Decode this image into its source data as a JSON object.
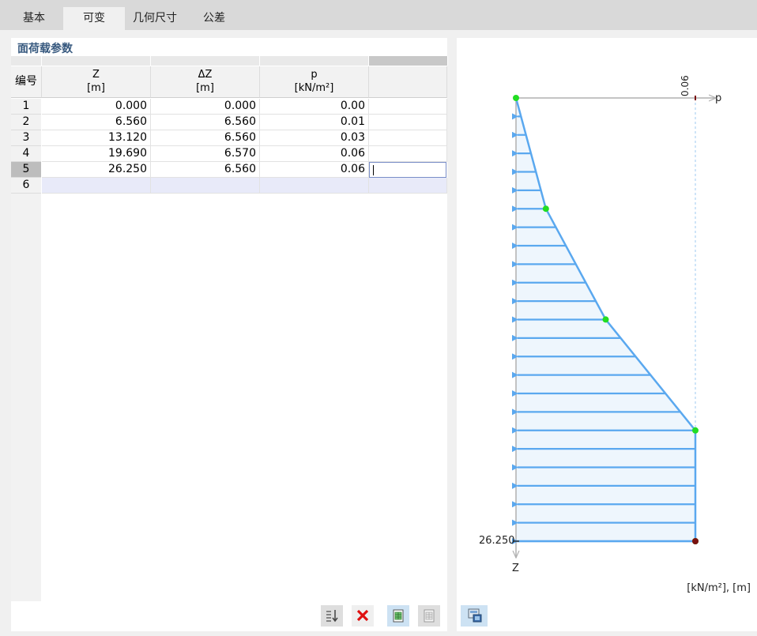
{
  "tabs": [
    {
      "label": "基本"
    },
    {
      "label": "可变"
    },
    {
      "label": "几何尺寸"
    },
    {
      "label": "公差"
    }
  ],
  "panel": {
    "title": "面荷载参数",
    "headers": {
      "num": "编号",
      "z": "Z",
      "z_unit": "[m]",
      "dz": "ΔZ",
      "dz_unit": "[m]",
      "p": "p",
      "p_unit": "[kN/m²]"
    },
    "rows": [
      {
        "num": "1",
        "z": "0.000",
        "dz": "0.000",
        "p": "0.00"
      },
      {
        "num": "2",
        "z": "6.560",
        "dz": "6.560",
        "p": "0.01"
      },
      {
        "num": "3",
        "z": "13.120",
        "dz": "6.560",
        "p": "0.03"
      },
      {
        "num": "4",
        "z": "19.690",
        "dz": "6.570",
        "p": "0.06"
      },
      {
        "num": "5",
        "z": "26.250",
        "dz": "6.560",
        "p": "0.06"
      },
      {
        "num": "6",
        "z": "",
        "dz": "",
        "p": ""
      }
    ]
  },
  "diagram": {
    "p_label": "p",
    "z_label": "Z",
    "max_p_label": "0.06",
    "max_z_label": "26.250",
    "units": "[kN/m²], [m]",
    "colors": {
      "load": "#5aa8ef",
      "fill": "#eef6fd",
      "node": "#22dd22",
      "end_node": "#7a1010",
      "axis": "#b0b0b0"
    }
  },
  "toolbar": {
    "icons": [
      "sort-icon",
      "delete-icon",
      "import-table-icon",
      "export-table-icon",
      "diagram-options-icon"
    ]
  }
}
